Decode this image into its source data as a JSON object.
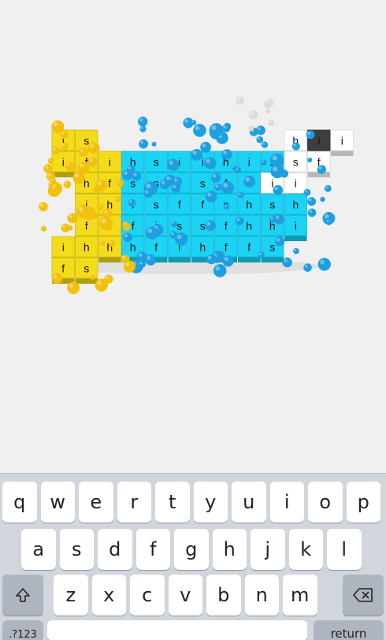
{
  "scene": {
    "title": "",
    "colors": {
      "yellow": "#f4dc1a",
      "cyan": "#1ad3f5",
      "white": "#ffffff",
      "dark": "#3d3d3d",
      "ball_blue": "#1e9fe0",
      "ball_yellow": "#f2c10e",
      "ball_grey": "#dcdcdc"
    },
    "cube_rows": [
      [
        "i",
        "s",
        null,
        null,
        null,
        null,
        null,
        null,
        null,
        null,
        "h",
        "i",
        "i"
      ],
      [
        "i",
        "f",
        "i",
        "h",
        "s",
        "i",
        "i",
        "h",
        "i",
        "s",
        "s",
        "f",
        null
      ],
      [
        null,
        "h",
        "f",
        "s",
        "s",
        "f",
        "s",
        "f",
        "i",
        "i",
        "i",
        null,
        null
      ],
      [
        null,
        "i",
        "h",
        "i",
        "s",
        "f",
        "f",
        "s",
        "h",
        "s",
        "h",
        null,
        null
      ],
      [
        null,
        "f",
        "f",
        "f",
        "i",
        "s",
        "s",
        "f",
        "h",
        "h",
        "i",
        null,
        null
      ],
      [
        "i",
        "h",
        "h",
        "h",
        "f",
        "i",
        "h",
        "f",
        "f",
        "s",
        null,
        null,
        null
      ],
      [
        "f",
        "s",
        null,
        null,
        null,
        null,
        null,
        null,
        null,
        null,
        null,
        null,
        null
      ]
    ]
  },
  "keyboard": {
    "row1": [
      "q",
      "w",
      "e",
      "r",
      "t",
      "y",
      "u",
      "i",
      "o",
      "p"
    ],
    "row2": [
      "a",
      "s",
      "d",
      "f",
      "g",
      "h",
      "j",
      "k",
      "l"
    ],
    "row3": [
      "z",
      "x",
      "c",
      "v",
      "b",
      "n",
      "m"
    ],
    "shift_icon": "shift-arrow-icon",
    "delete_icon": "backspace-icon",
    "numbers_label": ".?123",
    "return_label": "return"
  }
}
